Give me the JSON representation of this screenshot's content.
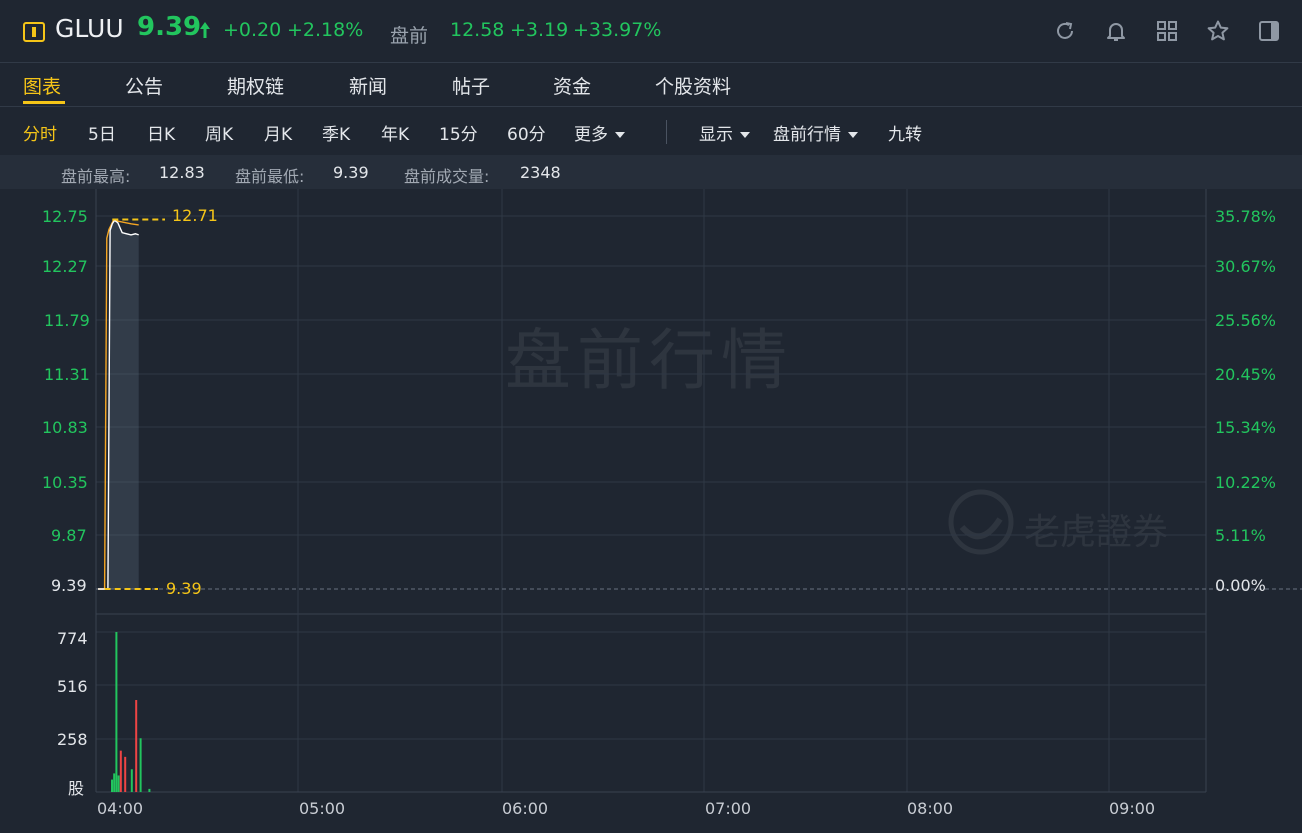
{
  "header": {
    "symbol": "GLUU",
    "price": "9.39",
    "change": "+0.20",
    "change_pct": "+2.18%",
    "premarket_label": "盘前",
    "premarket_price": "12.58",
    "premarket_change": "+3.19",
    "premarket_change_pct": "+33.97%",
    "icons": [
      "refresh-icon",
      "bell-icon",
      "grid-icon",
      "star-icon",
      "panel-icon"
    ]
  },
  "tabs": [
    "图表",
    "公告",
    "期权链",
    "新闻",
    "帖子",
    "资金",
    "个股资料"
  ],
  "periods": [
    "分时",
    "5日",
    "日K",
    "周K",
    "月K",
    "季K",
    "年K",
    "15分",
    "60分",
    "更多"
  ],
  "options": [
    "显示",
    "盘前行情",
    "九转"
  ],
  "stats": {
    "high_label": "盘前最高:",
    "high": "12.83",
    "low_label": "盘前最低:",
    "low": "9.39",
    "volume_label": "盘前成交量:",
    "volume": "2348"
  },
  "chart_data": {
    "type": "line",
    "price_axis": [
      "12.75",
      "12.27",
      "11.79",
      "11.31",
      "10.83",
      "10.35",
      "9.87",
      "9.39"
    ],
    "pct_axis": [
      "35.78%",
      "30.67%",
      "25.56%",
      "20.45%",
      "15.34%",
      "10.22%",
      "5.11%",
      "0.00%"
    ],
    "volume_axis": [
      "774",
      "516",
      "258",
      "股"
    ],
    "x_ticks": [
      "04:00",
      "05:00",
      "06:00",
      "07:00",
      "08:00",
      "09:00"
    ],
    "high_marker": "12.71",
    "base_marker": "9.39",
    "watermark": "盘前行情",
    "logo_text": "老虎證券",
    "price_line": [
      [
        0,
        9.39
      ],
      [
        6,
        9.39
      ],
      [
        9,
        9.39
      ],
      [
        11,
        12.62
      ],
      [
        13,
        12.68
      ],
      [
        15,
        12.71
      ],
      [
        18,
        12.69
      ],
      [
        22,
        12.6
      ],
      [
        26,
        12.59
      ],
      [
        30,
        12.58
      ],
      [
        34,
        12.59
      ],
      [
        37,
        12.58
      ]
    ],
    "avg_line": [
      [
        0,
        9.39
      ],
      [
        6,
        9.39
      ],
      [
        8,
        12.55
      ],
      [
        10,
        12.63
      ],
      [
        14,
        12.71
      ],
      [
        20,
        12.7
      ],
      [
        30,
        12.68
      ],
      [
        37,
        12.67
      ]
    ],
    "volume_bars": [
      {
        "m": 0,
        "v": 60,
        "dir": "up"
      },
      {
        "m": 1,
        "v": 90,
        "dir": "up"
      },
      {
        "m": 2,
        "v": 774,
        "dir": "up"
      },
      {
        "m": 3,
        "v": 80,
        "dir": "up"
      },
      {
        "m": 4,
        "v": 200,
        "dir": "down"
      },
      {
        "m": 6,
        "v": 170,
        "dir": "down"
      },
      {
        "m": 9,
        "v": 110,
        "dir": "up"
      },
      {
        "m": 11,
        "v": 445,
        "dir": "down"
      },
      {
        "m": 13,
        "v": 260,
        "dir": "up"
      },
      {
        "m": 17,
        "v": 15,
        "dir": "up"
      }
    ],
    "colors": {
      "up": "#22c55e",
      "down": "#ef4444",
      "price": "#ffffff",
      "avg": "#f5a623",
      "marker": "#f5c518"
    }
  }
}
